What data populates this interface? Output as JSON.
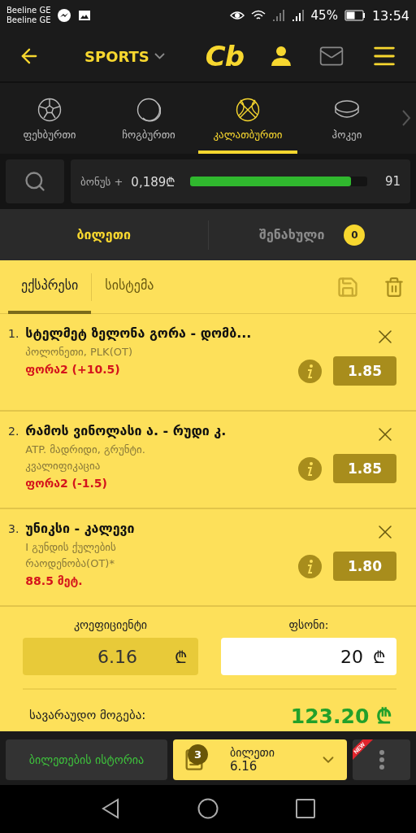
{
  "status_bar": {
    "carriers": [
      "Beeline GE",
      "Beeline GE"
    ],
    "battery": "45%",
    "time": "13:54"
  },
  "header": {
    "section": "SPORTS",
    "logo": "Cb"
  },
  "sport_tabs": [
    {
      "kind": "football",
      "label": "ფეხბურთი",
      "selected": false
    },
    {
      "kind": "tennis",
      "label": "ჩოგბურთი",
      "selected": false
    },
    {
      "kind": "basketball",
      "label": "კალათბურთი",
      "selected": true
    },
    {
      "kind": "hockey",
      "label": "ჰოკეი",
      "selected": false
    }
  ],
  "bonus": {
    "label": "ბონუს +",
    "amount": "0,189₾",
    "level": 0.91,
    "count": "91"
  },
  "ticket_tabs": [
    {
      "label": "ბილეთი",
      "selected": true
    },
    {
      "label": "შენახული",
      "selected": false,
      "badge": "0"
    }
  ],
  "bet_types": [
    {
      "label": "ექსპრესი",
      "selected": true
    },
    {
      "label": "სისტემა",
      "selected": false
    }
  ],
  "bets": [
    {
      "number": "1.",
      "title": "სტელმეტ ზელონა გორა - დომბ...",
      "league": "პოლონეთი, PLK(OT)",
      "market": "ფორა2 (+10.5)",
      "odds": "1.85"
    },
    {
      "number": "2.",
      "title": "რამოს ვინოლასი ა. - რუდი კ.",
      "league": "ATP. მადრიდი, გრუნტი. კვალიფიკაცია",
      "market": "ფორა2 (-1.5)",
      "odds": "1.85"
    },
    {
      "number": "3.",
      "title": "უნიკსი - კალევი",
      "league": "I გუნდის ქულების რაოდენობა(OT)*",
      "market": "88.5 მეტ.",
      "odds": "1.80"
    }
  ],
  "totals": {
    "coefficient_label": "კოეფიციენტი",
    "coefficient": "6.16",
    "coefficient_currency": "₾",
    "stake_label": "ფსონი:",
    "stake": "20",
    "stake_currency": "₾",
    "win_label": "სავარაუდო მოგება:",
    "win": "123.20 ₾"
  },
  "bottom_bar": {
    "history": "ბილეთების ისტორია",
    "ticket_count": "3",
    "ticket_label": "ბილეთი",
    "ticket_odds": "6.16",
    "new_badge": "NEW"
  }
}
